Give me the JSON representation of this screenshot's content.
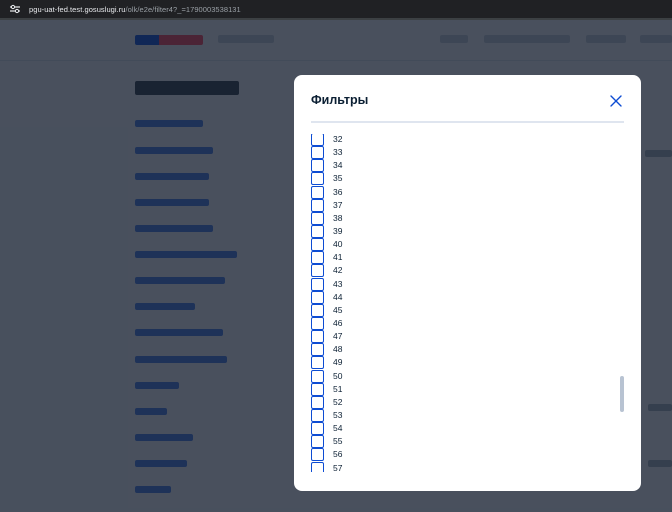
{
  "browser": {
    "url_domain": "pgu-uat-fed.test.gosuslugi.ru",
    "url_path": "/olk/e2e/filter4?_=1790003538131"
  },
  "modal": {
    "title": "Фильтры",
    "close_icon": "close-icon",
    "accent_color": "#0d4cd3",
    "options": [
      {
        "label": "32",
        "checked": false
      },
      {
        "label": "33",
        "checked": false
      },
      {
        "label": "34",
        "checked": false
      },
      {
        "label": "35",
        "checked": false
      },
      {
        "label": "36",
        "checked": false
      },
      {
        "label": "37",
        "checked": false
      },
      {
        "label": "38",
        "checked": false
      },
      {
        "label": "39",
        "checked": false
      },
      {
        "label": "40",
        "checked": false
      },
      {
        "label": "41",
        "checked": false
      },
      {
        "label": "42",
        "checked": false
      },
      {
        "label": "43",
        "checked": false
      },
      {
        "label": "44",
        "checked": false
      },
      {
        "label": "45",
        "checked": false
      },
      {
        "label": "46",
        "checked": false
      },
      {
        "label": "47",
        "checked": false
      },
      {
        "label": "48",
        "checked": false
      },
      {
        "label": "49",
        "checked": false
      },
      {
        "label": "50",
        "checked": false
      },
      {
        "label": "51",
        "checked": false
      },
      {
        "label": "52",
        "checked": false
      },
      {
        "label": "53",
        "checked": false
      },
      {
        "label": "54",
        "checked": false
      },
      {
        "label": "55",
        "checked": false
      },
      {
        "label": "56",
        "checked": false
      },
      {
        "label": "57",
        "checked": false
      }
    ],
    "scroll_position": 0.8
  }
}
